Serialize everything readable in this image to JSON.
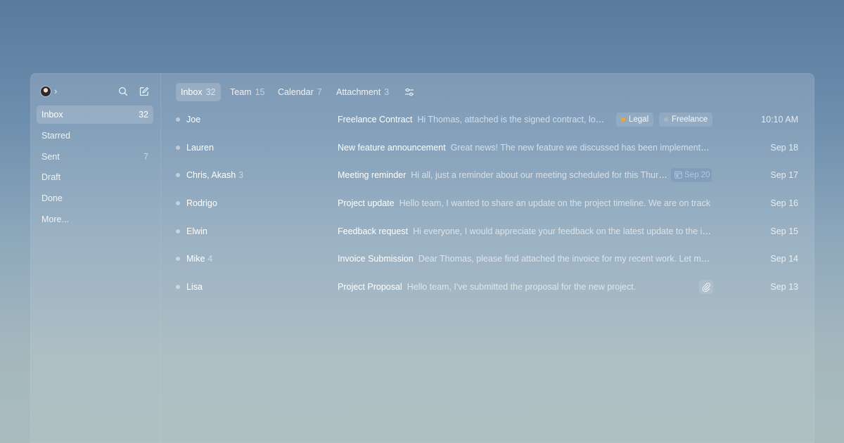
{
  "sidebar": {
    "items": [
      {
        "label": "Inbox",
        "count": "32"
      },
      {
        "label": "Starred",
        "count": ""
      },
      {
        "label": "Sent",
        "count": "7"
      },
      {
        "label": "Draft",
        "count": ""
      },
      {
        "label": "Done",
        "count": ""
      },
      {
        "label": "More...",
        "count": ""
      }
    ]
  },
  "tabs": [
    {
      "label": "Inbox",
      "count": "32"
    },
    {
      "label": "Team",
      "count": "15"
    },
    {
      "label": "Calendar",
      "count": "7"
    },
    {
      "label": "Attachment",
      "count": "3"
    }
  ],
  "emails": [
    {
      "sender": "Joe",
      "thread_count": "",
      "subject": "Freelance Contract",
      "preview": "Hi Thomas, attached is the signed contract, looking forward to working with you",
      "date": "10:10 AM"
    },
    {
      "sender": "Lauren",
      "thread_count": "",
      "subject": "New feature announcement",
      "preview": "Great news! The new feature we discussed has been implemented and is live",
      "date": "Sep 18"
    },
    {
      "sender": "Chris, Akash",
      "thread_count": "3",
      "subject": "Meeting reminder",
      "preview": "Hi all, just a reminder about our meeting scheduled for this Thursday",
      "date": "Sep 17"
    },
    {
      "sender": "Rodrigo",
      "thread_count": "",
      "subject": "Project update",
      "preview": "Hello team, I wanted to share an update on the project timeline. We are on track",
      "date": "Sep 16"
    },
    {
      "sender": "Elwin",
      "thread_count": "",
      "subject": "Feedback request",
      "preview": "Hi everyone, I would appreciate your feedback on the latest update to the interface",
      "date": "Sep 15"
    },
    {
      "sender": "Mike",
      "thread_count": "4",
      "subject": "Invoice Submission",
      "preview": "Dear Thomas, please find attached the invoice for my recent work. Let me know",
      "date": "Sep 14"
    },
    {
      "sender": "Lisa",
      "thread_count": "",
      "subject": "Project Proposal",
      "preview": "Hello team, I've submitted the proposal for the new project.",
      "date": "Sep 13"
    }
  ],
  "tags": {
    "legal": {
      "label": "Legal",
      "color": "#f5a623"
    },
    "freelance": {
      "label": "Freelance",
      "color": "#a9b7c6"
    }
  },
  "calendar_chip": {
    "label": "Sep 20"
  },
  "icons": {
    "profile": "avatar",
    "chevron": "chevron-right-icon",
    "search": "search-icon",
    "compose": "compose-icon",
    "filter": "filter-sliders-icon",
    "calendar": "calendar-icon",
    "attachment": "paperclip-icon"
  }
}
